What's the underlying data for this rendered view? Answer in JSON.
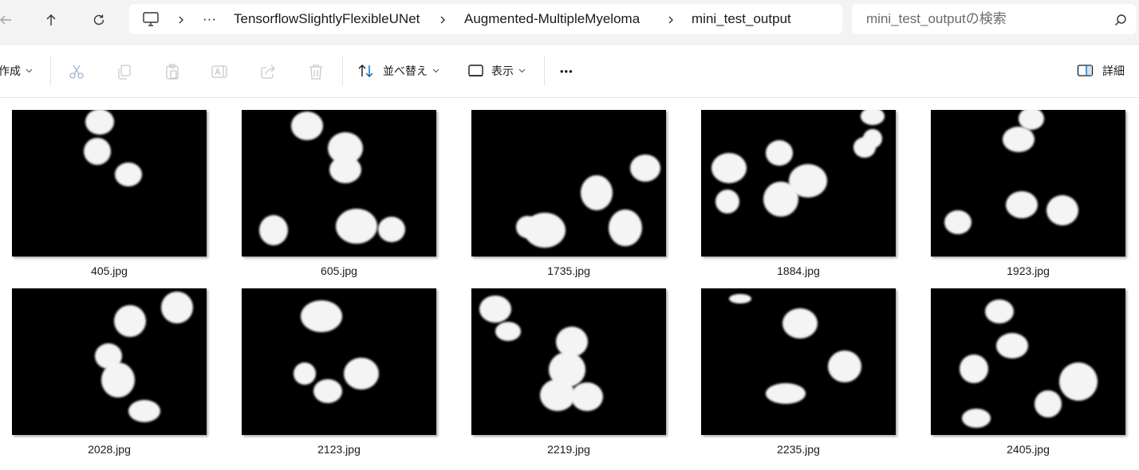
{
  "nav": {
    "back_icon": "arrow-left-icon",
    "up_icon": "arrow-up-icon",
    "refresh_icon": "refresh-icon"
  },
  "address": {
    "computer_icon": "monitor-icon",
    "overflow": "···",
    "crumbs": [
      "TensorflowSlightlyFlexibleUNet",
      "Augmented-MultipleMyeloma",
      "mini_test_output"
    ]
  },
  "search": {
    "placeholder": "mini_test_outputの検索",
    "icon": "search-icon"
  },
  "toolbar": {
    "new_label": "作成",
    "sort_label": "並べ替え",
    "view_label": "表示",
    "more_label": "•••",
    "details_label": "詳細",
    "icons": [
      "cut-icon",
      "copy-icon",
      "paste-icon",
      "rename-icon",
      "share-icon",
      "delete-icon"
    ]
  },
  "files": [
    {
      "name": "405.jpg"
    },
    {
      "name": "605.jpg"
    },
    {
      "name": "1735.jpg"
    },
    {
      "name": "1884.jpg"
    },
    {
      "name": "1923.jpg"
    },
    {
      "name": "2028.jpg"
    },
    {
      "name": "2123.jpg"
    },
    {
      "name": "2219.jpg"
    },
    {
      "name": "2235.jpg"
    },
    {
      "name": "2405.jpg"
    }
  ],
  "colors": {
    "background": "#ffffff",
    "topbar": "#f3f3f3",
    "thumb_background": "#000000",
    "accent": "#0067c0"
  }
}
